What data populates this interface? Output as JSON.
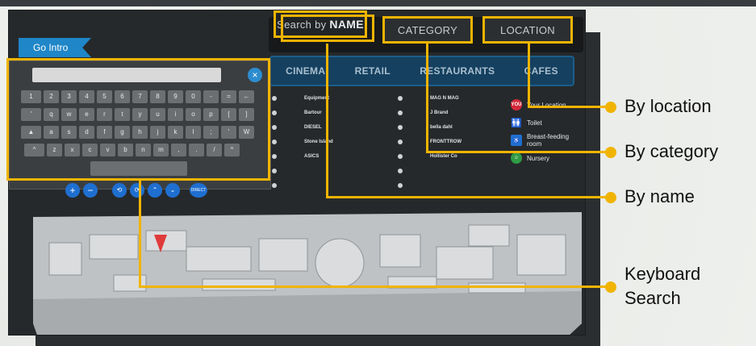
{
  "screen": {
    "go_intro": "Go Intro",
    "search": {
      "by_label": "Search by",
      "name_label": "NAME",
      "category_label": "CATEGORY",
      "location_label": "LOCATION"
    },
    "tabs": [
      "CINEMA",
      "RETAIL",
      "RESTAURANTS",
      "CAFES"
    ],
    "keyboard": {
      "close": "×",
      "row1": [
        "1",
        "2",
        "3",
        "4",
        "5",
        "6",
        "7",
        "8",
        "9",
        "0",
        "-",
        "=",
        "←"
      ],
      "row2": [
        "'",
        "q",
        "w",
        "e",
        "r",
        "t",
        "y",
        "u",
        "i",
        "o",
        "p",
        "[",
        "]"
      ],
      "row3": [
        "▲",
        "a",
        "s",
        "d",
        "f",
        "g",
        "h",
        "j",
        "k",
        "l",
        ";",
        "'",
        "W"
      ],
      "row4": [
        "^",
        "z",
        "x",
        "c",
        "v",
        "b",
        "n",
        "m",
        ",",
        ".",
        "/",
        "^"
      ]
    },
    "zoom": {
      "plus": "+",
      "minus": "−",
      "direct": "DIRECT"
    },
    "store_list_1": [
      "Equipment",
      "Bartour",
      "DIESEL",
      "Stone Island",
      "ASICS",
      "",
      ""
    ],
    "store_list_2": [
      "MAG N MAG",
      "J Brand",
      "bella dahl",
      "FRONTTROW",
      "Hollister Co",
      "",
      ""
    ],
    "legend": {
      "you_badge": "YOU",
      "your_location": "Your Location",
      "toilet": "Toilet",
      "breastfeeding": "Breast-feeding room",
      "nursery": "Nursery"
    }
  },
  "callouts": {
    "by_location": "By location",
    "by_category": "By category",
    "by_name": "By name",
    "keyboard_search": "Keyboard Search"
  },
  "colors": {
    "highlight": "#f0b400",
    "accent": "#1f86c8",
    "screen_bg": "#26292b"
  }
}
